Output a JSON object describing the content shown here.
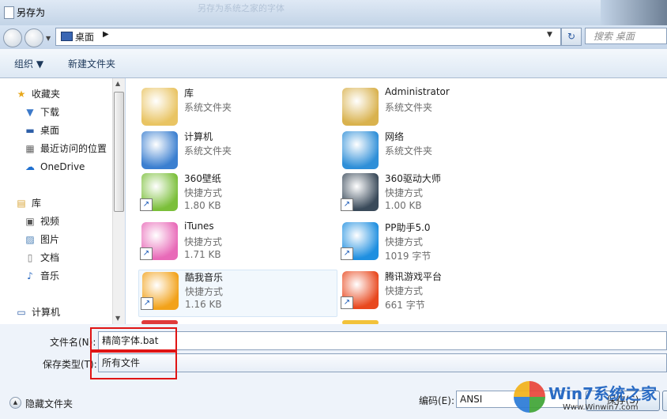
{
  "window": {
    "title": "另存为",
    "ghost_title": "另存为系统之家的字体"
  },
  "address": {
    "location": "桌面",
    "arrow": "▶",
    "dropdown": "▼",
    "refresh": "↻",
    "search_placeholder": "搜索 桌面"
  },
  "toolbar": {
    "organize": "组织 ▼",
    "new_folder": "新建文件夹"
  },
  "sidebar": {
    "items": [
      {
        "label": "收藏夹",
        "icon": "star-icon",
        "glyph": "★",
        "color": "#e8a81c"
      },
      {
        "label": "下载",
        "icon": "download-folder-icon",
        "glyph": "▼",
        "color": "#3c79c9"
      },
      {
        "label": "桌面",
        "icon": "desktop-icon",
        "glyph": "▬",
        "color": "#2e5fa8"
      },
      {
        "label": "最近访问的位置",
        "icon": "recent-places-icon",
        "glyph": "▦",
        "color": "#666666"
      },
      {
        "label": "OneDrive",
        "icon": "cloud-icon",
        "glyph": "☁",
        "color": "#1f6fcf"
      },
      {
        "label": "库",
        "icon": "library-icon",
        "glyph": "▤",
        "color": "#d9a63a"
      },
      {
        "label": "视频",
        "icon": "video-icon",
        "glyph": "▣",
        "color": "#555555"
      },
      {
        "label": "图片",
        "icon": "pictures-icon",
        "glyph": "▨",
        "color": "#4a7fb5"
      },
      {
        "label": "文档",
        "icon": "documents-icon",
        "glyph": "▯",
        "color": "#777777"
      },
      {
        "label": "音乐",
        "icon": "music-icon",
        "glyph": "♪",
        "color": "#2d6bc0"
      },
      {
        "label": "计算机",
        "icon": "computer-icon",
        "glyph": "▭",
        "color": "#2e5fa8"
      }
    ]
  },
  "files": [
    {
      "name": "库",
      "type": "系统文件夹",
      "size": "",
      "icon": "library-folder-icon",
      "color": "#e9c463",
      "shortcut": false
    },
    {
      "name": "Administrator",
      "type": "系统文件夹",
      "size": "",
      "icon": "user-folder-icon",
      "color": "#d9b24e",
      "shortcut": false
    },
    {
      "name": "计算机",
      "type": "系统文件夹",
      "size": "",
      "icon": "computer-icon",
      "color": "#3b7fd0",
      "shortcut": false
    },
    {
      "name": "网络",
      "type": "系统文件夹",
      "size": "",
      "icon": "network-globe-icon",
      "color": "#2f8fd8",
      "shortcut": false
    },
    {
      "name": "360壁纸",
      "type": "快捷方式",
      "size": "1.80 KB",
      "icon": "wallpaper-app-icon",
      "color": "#7bbf3a",
      "shortcut": true
    },
    {
      "name": "360驱动大师",
      "type": "快捷方式",
      "size": "1.00 KB",
      "icon": "driver-master-icon",
      "color": "#3a4a5a",
      "shortcut": true
    },
    {
      "name": "iTunes",
      "type": "快捷方式",
      "size": "1.71 KB",
      "icon": "itunes-icon",
      "color": "#e86ab8",
      "shortcut": true
    },
    {
      "name": "PP助手5.0",
      "type": "快捷方式",
      "size": "1019 字节",
      "icon": "pp-assistant-icon",
      "color": "#1f8fe0",
      "shortcut": true
    },
    {
      "name": "酷我音乐",
      "type": "快捷方式",
      "size": "1.16 KB",
      "icon": "kuwo-music-icon",
      "color": "#f2a21a",
      "shortcut": true,
      "selected": true
    },
    {
      "name": "腾讯游戏平台",
      "type": "快捷方式",
      "size": "661 字节",
      "icon": "tencent-games-icon",
      "color": "#e8481e",
      "shortcut": true
    }
  ],
  "form": {
    "filename_label": "文件名(N):",
    "filename_value": "精简字体.bat",
    "filetype_label": "保存类型(T):",
    "filetype_value": "所有文件",
    "hide_folders": "隐藏文件夹",
    "encoding_label": "编码(E):",
    "encoding_value": "ANSI",
    "save_label": "保存(S)"
  },
  "watermark": {
    "brand": "Win7系统之家",
    "url": "Www.Winwin7.com"
  },
  "colors": {
    "highlight": "#e01414",
    "accent": "#2b6cc4"
  }
}
